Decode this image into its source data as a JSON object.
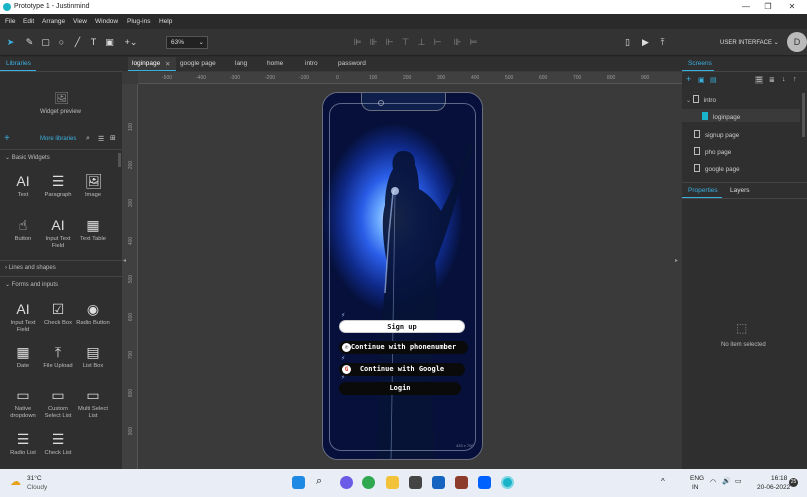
{
  "titlebar": {
    "title": "Prototype 1 - Justinmind",
    "minimize": "—",
    "maximize": "❐",
    "close": "✕"
  },
  "menu": [
    "File",
    "Edit",
    "Arrange",
    "View",
    "Window",
    "Plug-ins",
    "Help"
  ],
  "toolbar": {
    "zoom": "63%",
    "zoom_chevron": "⌄",
    "mode_label": "USER INTERFACE ⌄",
    "avatar_letter": "D"
  },
  "left_panel": {
    "tab": "Libraries",
    "widget_preview_label": "Widget preview",
    "more_libraries": "More libraries",
    "sections": {
      "basic": "⌄ Basic Widgets",
      "lines": "› Lines and shapes",
      "forms": "⌄ Forms and inputs"
    },
    "widgets": [
      {
        "label": "Text",
        "icon": "AI"
      },
      {
        "label": "Paragraph",
        "icon": "☰"
      },
      {
        "label": "Image",
        "icon": "🖼"
      },
      {
        "label": "Button",
        "icon": "☝"
      },
      {
        "label": "Input Text Field",
        "icon": "AI"
      },
      {
        "label": "Text Table",
        "icon": "▦"
      },
      {
        "label": "Input Text Field",
        "icon": "AI"
      },
      {
        "label": "Check Box",
        "icon": "☑"
      },
      {
        "label": "Radio Button",
        "icon": "◉"
      },
      {
        "label": "Date",
        "icon": "▦"
      },
      {
        "label": "File Upload",
        "icon": "⤒"
      },
      {
        "label": "List Box",
        "icon": "▤"
      },
      {
        "label": "Native dropdown",
        "icon": "▭"
      },
      {
        "label": "Custom Select List",
        "icon": "▭"
      },
      {
        "label": "Multi Select List",
        "icon": "▭"
      },
      {
        "label": "Radio List",
        "icon": "☰"
      },
      {
        "label": "Check List",
        "icon": "☰"
      }
    ]
  },
  "canvas_tabs": [
    "loginpage",
    "google page",
    "lang",
    "home",
    "intro",
    "password"
  ],
  "ruler_h": [
    "-500",
    "-400",
    "-300",
    "-200",
    "-100",
    "0",
    "100",
    "200",
    "300",
    "400",
    "500",
    "600",
    "700",
    "800",
    "900"
  ],
  "ruler_v": [
    "100",
    "200",
    "300",
    "400",
    "500",
    "600",
    "700",
    "800",
    "900"
  ],
  "phone": {
    "buttons": {
      "signup": "Sign up",
      "phone": "Continue with phonenumber",
      "google": "Continue with Google",
      "login": "Login"
    },
    "size_label": "433 x 700"
  },
  "right_panel": {
    "tab": "Screens",
    "screens": [
      {
        "label": "intro",
        "indent": 0
      },
      {
        "label": "loginpage",
        "indent": 1
      },
      {
        "label": "signup page",
        "indent": 0
      },
      {
        "label": "pho page",
        "indent": 0
      },
      {
        "label": "google page",
        "indent": 0
      }
    ],
    "tabs2": [
      "Properties",
      "Layers"
    ],
    "empty_label": "No item selected"
  },
  "taskbar": {
    "weather_temp": "31°C",
    "weather_desc": "Cloudy",
    "lang1": "ENG",
    "lang2": "IN",
    "time": "16:18",
    "date": "20-06-2022"
  },
  "colors": {
    "accent": "#3ab0e0",
    "app_bg": "#2b2b2b",
    "panel": "#2f2f2f"
  }
}
